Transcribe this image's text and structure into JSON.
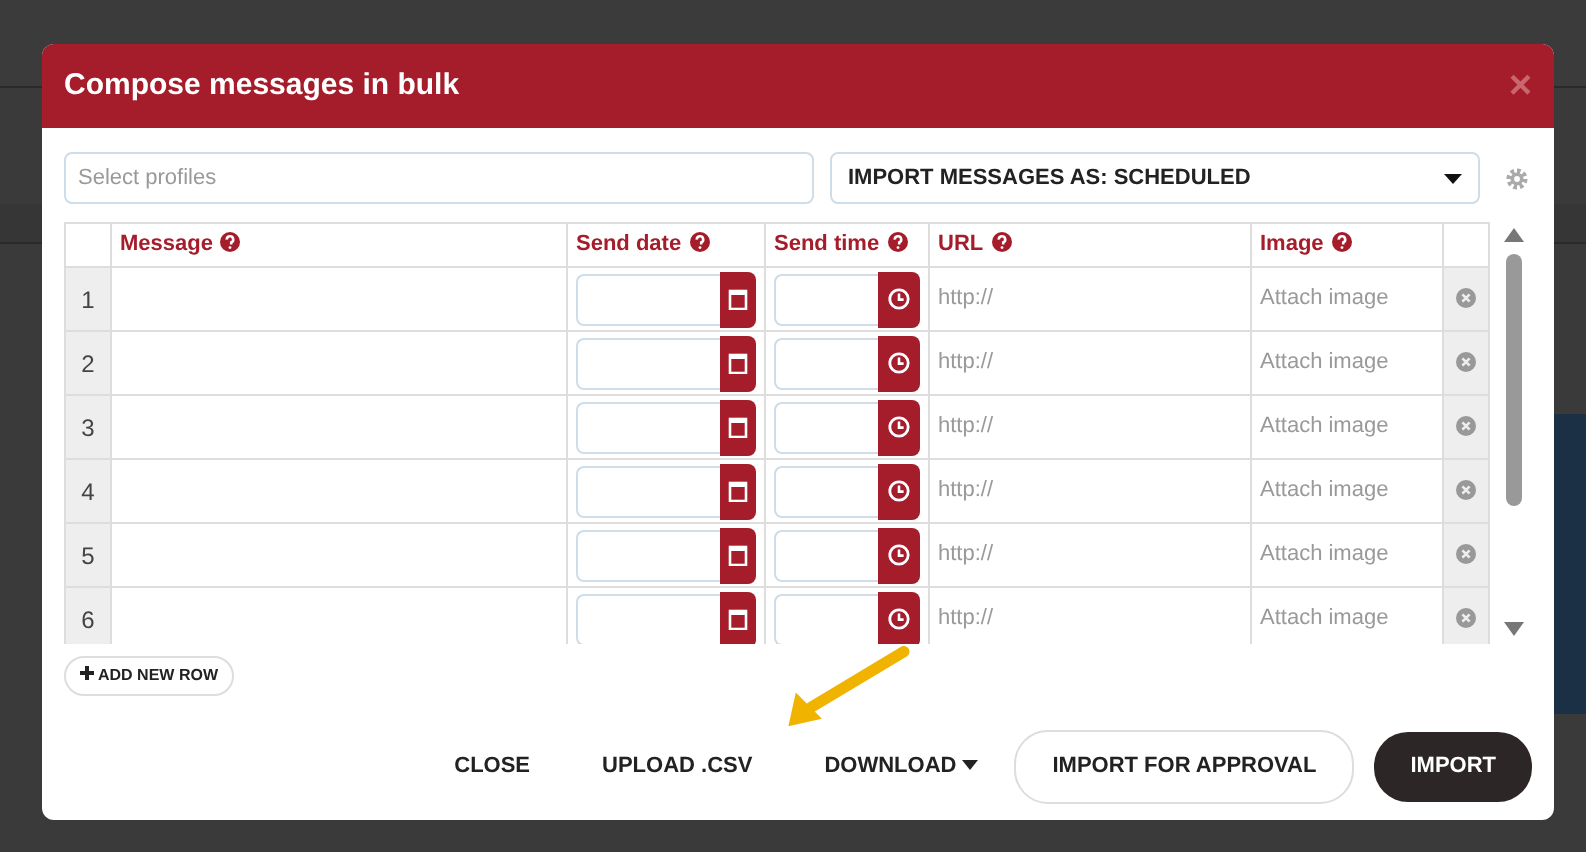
{
  "modal": {
    "title": "Compose messages in bulk",
    "close": "×",
    "profiles": {
      "placeholder": "Select profiles"
    },
    "import_as": {
      "value": "IMPORT MESSAGES AS: SCHEDULED"
    },
    "table": {
      "columns": [
        "Message",
        "Send date",
        "Send time",
        "URL",
        "Image"
      ],
      "rows": [
        {
          "number": "1",
          "url": {
            "placeholder": "http://"
          },
          "image": "Attach image"
        },
        {
          "number": "2",
          "url": {
            "placeholder": "http://"
          },
          "image": "Attach image"
        },
        {
          "number": "3",
          "url": {
            "placeholder": "http://"
          },
          "image": "Attach image"
        },
        {
          "number": "4",
          "url": {
            "placeholder": "http://"
          },
          "image": "Attach image"
        },
        {
          "number": "5",
          "url": {
            "placeholder": "http://"
          },
          "image": "Attach image"
        },
        {
          "number": "6",
          "url": {
            "placeholder": "http://"
          },
          "image": "Attach image"
        }
      ]
    },
    "add_row": "ADD NEW ROW",
    "footer_buttons": [
      {
        "label": "CLOSE",
        "kind": "link"
      },
      {
        "label": "UPLOAD .CSV",
        "kind": "link"
      },
      {
        "label": "DOWNLOAD",
        "kind": "dropdown"
      },
      {
        "label": "IMPORT FOR APPROVAL",
        "kind": "outline"
      },
      {
        "label": "IMPORT",
        "kind": "dark"
      }
    ]
  }
}
